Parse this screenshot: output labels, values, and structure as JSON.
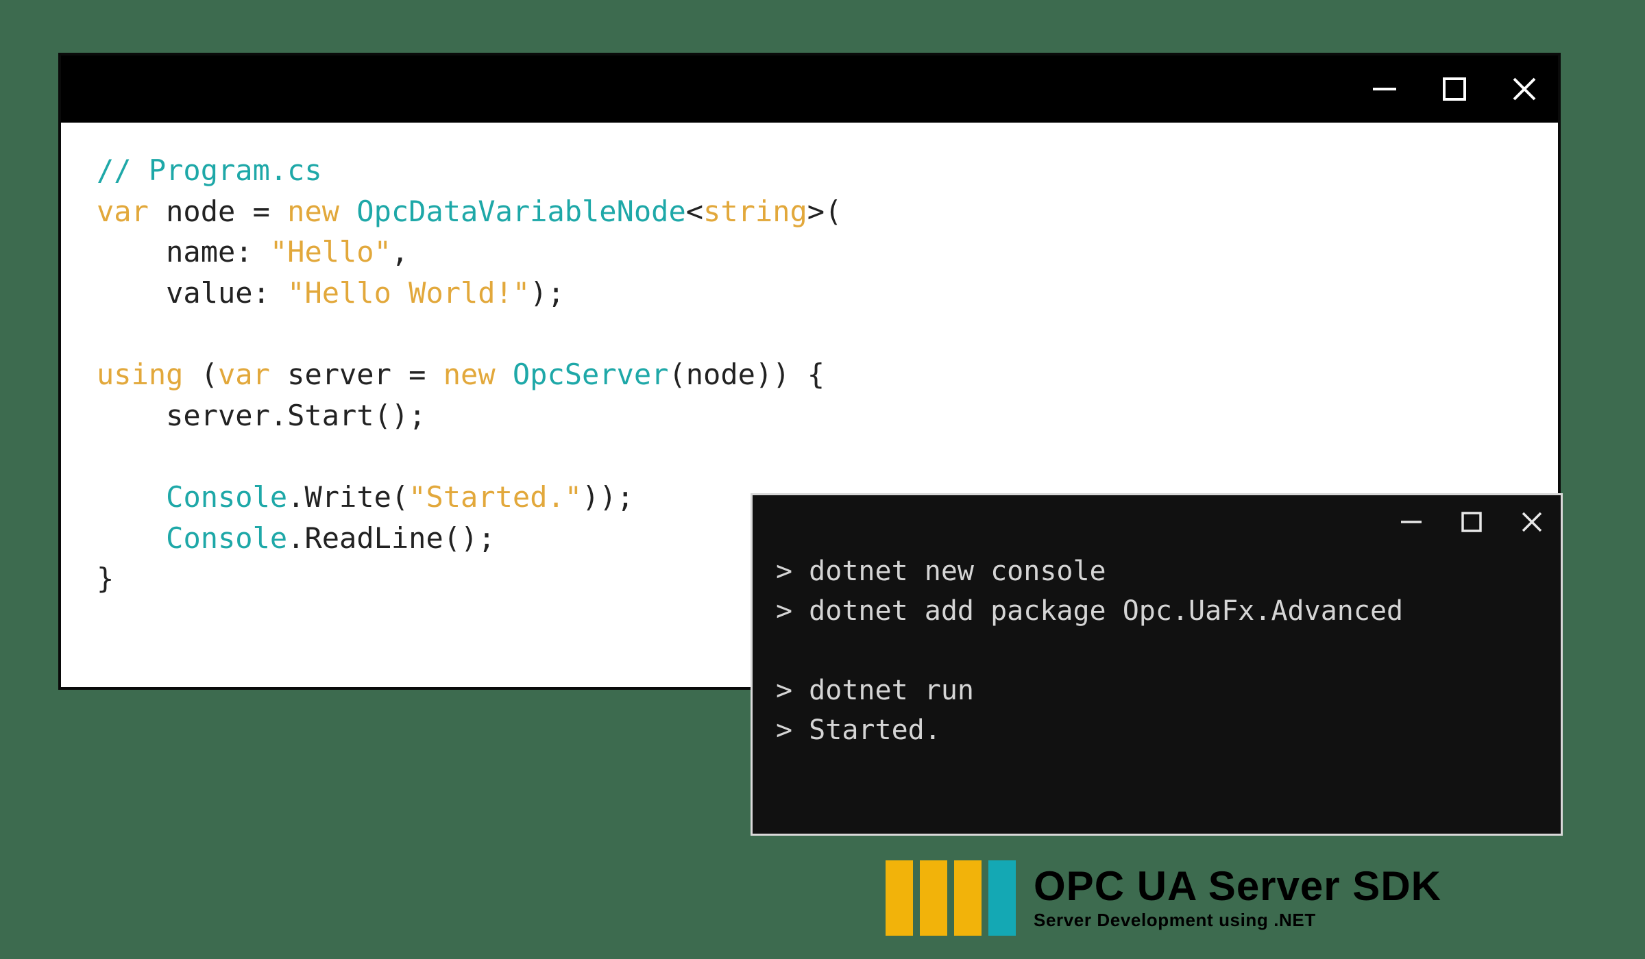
{
  "code": {
    "l1_comment": "// Program.cs",
    "l2_var": "var",
    "l2_rest": " node = ",
    "l2_new": "new",
    "l2_type": " OpcDataVariableNode",
    "l2_lt": "<",
    "l2_gen": "string",
    "l2_gt": ">",
    "l2_open": "(",
    "l3_pre": "    name: ",
    "l3_str": "\"Hello\"",
    "l3_post": ",",
    "l4_pre": "    value: ",
    "l4_str": "\"Hello World!\"",
    "l4_post": ");",
    "l5": "",
    "l6_using": "using",
    "l6_mid": " (",
    "l6_var": "var",
    "l6_rest": " server = ",
    "l6_new": "new",
    "l6_type": " OpcServer",
    "l6_tail": "(node)) {",
    "l7": "    server.Start();",
    "l8": "",
    "l9_pre": "    ",
    "l9_console": "Console",
    "l9_mid": ".Write(",
    "l9_str": "\"Started.\"",
    "l9_post": "));",
    "l10_pre": "    ",
    "l10_console": "Console",
    "l10_post": ".ReadLine();",
    "l11": "}"
  },
  "terminal": {
    "t1": "> dotnet new console",
    "t2": "> dotnet add package Opc.UaFx.Advanced",
    "t3": "",
    "t4": "> dotnet run",
    "t5": "> Started."
  },
  "logo": {
    "title_main": "OPC UA Server ",
    "title_sdk": " SDK",
    "subtitle": "Server Development using .NET"
  }
}
